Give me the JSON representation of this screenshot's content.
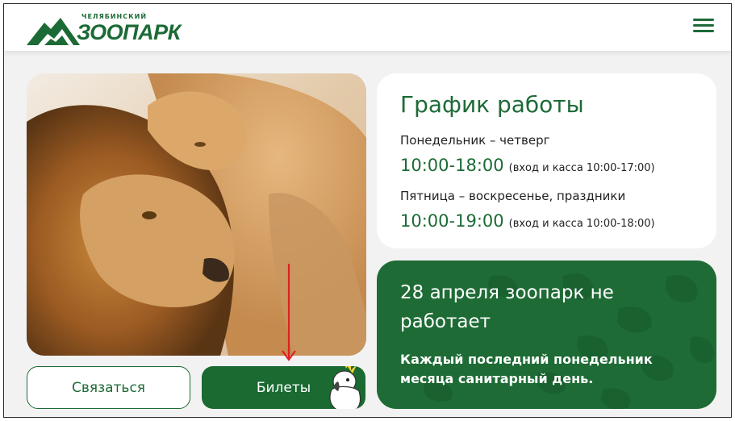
{
  "header": {
    "logo_small": "ЧЕЛЯБИНСКИЙ",
    "logo_big": "ЗООПАРК",
    "menu_icon": "hamburger-menu-icon"
  },
  "hero": {
    "photo": "two-lions-photo"
  },
  "actions": {
    "contact_label": "Связаться",
    "tickets_label": "Билеты"
  },
  "schedule": {
    "title": "График работы",
    "rows": [
      {
        "days": "Понедельник – четверг",
        "time": "10:00-18:00",
        "note": "(вход и касса 10:00-17:00)"
      },
      {
        "days": "Пятница – воскресенье, праздники",
        "time": "10:00-19:00",
        "note": "(вход и касса 10:00-18:00)"
      }
    ]
  },
  "notice": {
    "title": "28 апреля зоопарк не работает",
    "text": "Каждый последний понедельник месяца  санитарный день."
  },
  "colors": {
    "brand_green": "#1c6b36",
    "card_green": "#1e6b35",
    "annotation_red": "#e02020"
  }
}
